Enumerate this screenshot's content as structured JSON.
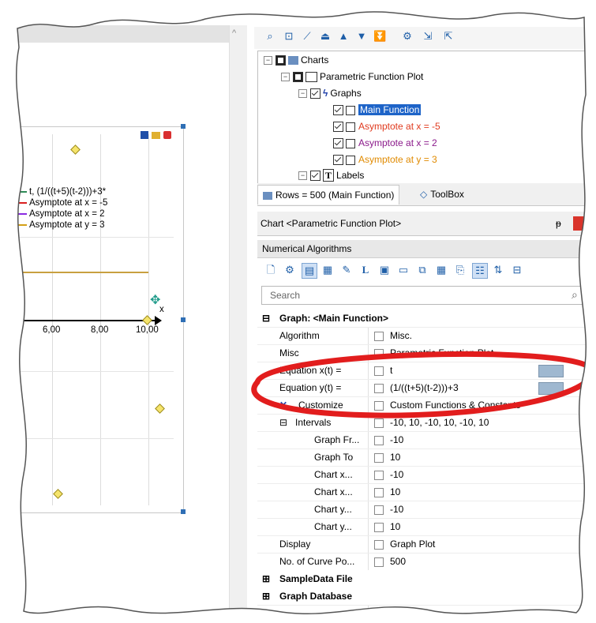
{
  "chart": {
    "x_ticks": [
      "6,00",
      "8,00",
      "10,00"
    ],
    "x_axis_label": "x",
    "legend": [
      {
        "label": "t, (1/((t+5)(t-2)))+3*",
        "color": "#2e8b57"
      },
      {
        "label": "Asymptote at x = -5",
        "color": "#d92020"
      },
      {
        "label": "Asymptote at x = 2",
        "color": "#8a2be2"
      },
      {
        "label": "Asymptote at y = 3",
        "color": "#d4a017"
      }
    ]
  },
  "tree": {
    "root": "Charts",
    "plot": "Parametric Function Plot",
    "graphs": "Graphs",
    "items": [
      {
        "label": "Main Function",
        "color": "#ffffff",
        "selected": true
      },
      {
        "label": "Asymptote at x = -5",
        "color": "#e03a1e",
        "selected": false
      },
      {
        "label": "Asymptote at x = 2",
        "color": "#8b1a8b",
        "selected": false
      },
      {
        "label": "Asymptote at y = 3",
        "color": "#e08a00",
        "selected": false
      }
    ],
    "labels": "Labels"
  },
  "tabs": {
    "rows": "Rows = 500 (Main Function)",
    "toolbox": "ToolBox"
  },
  "properties": {
    "title": "Chart <Parametric Function Plot>",
    "pin": "ᵽ",
    "category_bar": "Numerical Algorithms",
    "search_placeholder": "Search",
    "category_graph": "Graph: <Main Function>",
    "rows": [
      {
        "name": "Algorithm",
        "value": "Misc."
      },
      {
        "name": "Misc",
        "value": "Parametric Function Plot"
      },
      {
        "name": "Equation x(t) =",
        "value": "t"
      },
      {
        "name": "Equation y(t) =",
        "value": "(1/((t+5)(t-2)))+3"
      },
      {
        "name": "Customize",
        "value": "Custom Functions & Constants"
      },
      {
        "name": "Intervals",
        "value": "-10, 10, -10, 10, -10, 10"
      },
      {
        "name": "Graph Fr...",
        "value": "-10"
      },
      {
        "name": "Graph To",
        "value": "10"
      },
      {
        "name": "Chart x...",
        "value": "-10"
      },
      {
        "name": "Chart x...",
        "value": "10"
      },
      {
        "name": "Chart y...",
        "value": "-10"
      },
      {
        "name": "Chart y...",
        "value": "10"
      },
      {
        "name": "Display",
        "value": "Graph Plot"
      },
      {
        "name": "No. of Curve Po...",
        "value": "500"
      }
    ],
    "category_sample": "SampleData File",
    "category_db": "Graph Database"
  }
}
